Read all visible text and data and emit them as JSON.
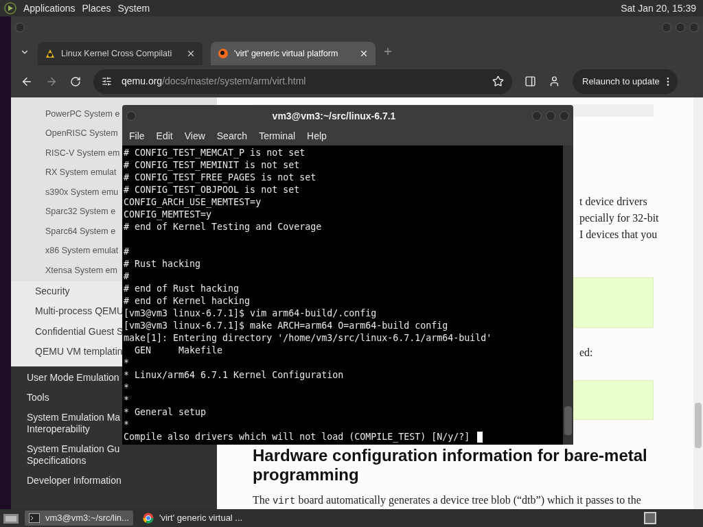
{
  "top_panel": {
    "menus": [
      "Applications",
      "Places",
      "System"
    ],
    "clock": "Sat Jan 20, 15:39"
  },
  "browser": {
    "tabs": [
      {
        "title": "Linux Kernel Cross Compilati",
        "selected": false,
        "kind": "penguin"
      },
      {
        "title": "'virt' generic virtual platform",
        "selected": true,
        "kind": "qemu"
      }
    ],
    "url": {
      "host": "qemu.org",
      "path": "/docs/master/system/arm/virt.html"
    },
    "relaunch_button": "Relaunch to update",
    "sidebar": {
      "nested_items": [
        "PowerPC System e",
        "OpenRISC System",
        "RISC-V System em",
        "RX System emulat",
        "s390x System emu",
        "Sparc32 System e",
        "Sparc64 System e",
        "x86 System emulat",
        "Xtensa System em"
      ],
      "items": [
        "Security",
        "Multi-process QEMU",
        "Confidential Guest S",
        "QEMU VM templatin"
      ],
      "top_items": [
        {
          "lines": [
            "User Mode Emulation"
          ]
        },
        {
          "lines": [
            "Tools"
          ]
        },
        {
          "lines": [
            "System Emulation Ma",
            "Interoperability"
          ]
        },
        {
          "lines": [
            "System Emulation Gu",
            "Specifications"
          ]
        },
        {
          "lines": [
            "Developer Information"
          ]
        }
      ]
    },
    "page": {
      "partial_lines": [
        "t device drivers",
        "pecially for 32-bit",
        "I devices that you"
      ],
      "note": "ed:",
      "heading_lines": [
        "Hardware configuration information for bare-metal",
        "programming"
      ],
      "paragraph": [
        {
          "kind": "text",
          "text": "The "
        },
        {
          "kind": "code",
          "text": "virt"
        },
        {
          "kind": "text",
          "text": " board automatically generates a device tree blob (“dtb”) which it passes to the"
        }
      ]
    }
  },
  "terminal": {
    "title": "vm3@vm3:~/src/linux-6.7.1",
    "menu": [
      "File",
      "Edit",
      "View",
      "Search",
      "Terminal",
      "Help"
    ],
    "line_groups": [
      [
        "# CONFIG_TEST_MEMCAT_P is not set",
        "# CONFIG_TEST_MEMINIT is not set",
        "# CONFIG_TEST_FREE_PAGES is not set",
        "# CONFIG_TEST_OBJPOOL is not set",
        "CONFIG_ARCH_USE_MEMTEST=y",
        "CONFIG_MEMTEST=y",
        "# end of Kernel Testing and Coverage"
      ],
      [
        "#",
        "# Rust hacking",
        "#",
        "# end of Rust hacking",
        "# end of Kernel hacking",
        "[vm3@vm3 linux-6.7.1]$ vim arm64-build/.config",
        "[vm3@vm3 linux-6.7.1]$ make ARCH=arm64 O=arm64-build config",
        "make[1]: Entering directory '/home/vm3/src/linux-6.7.1/arm64-build'",
        "  GEN     Makefile",
        "*",
        "* Linux/arm64 6.7.1 Kernel Configuration",
        "*",
        "*",
        "* General setup",
        "*",
        "Compile also drivers which will not load (COMPILE_TEST) [N/y/?]"
      ]
    ]
  },
  "taskbar": {
    "tasks": [
      {
        "label": "vm3@vm3:~/src/lin...",
        "selected": true,
        "kind": "terminal"
      },
      {
        "label": "'virt' generic virtual ...",
        "selected": false,
        "kind": "browser"
      }
    ]
  }
}
